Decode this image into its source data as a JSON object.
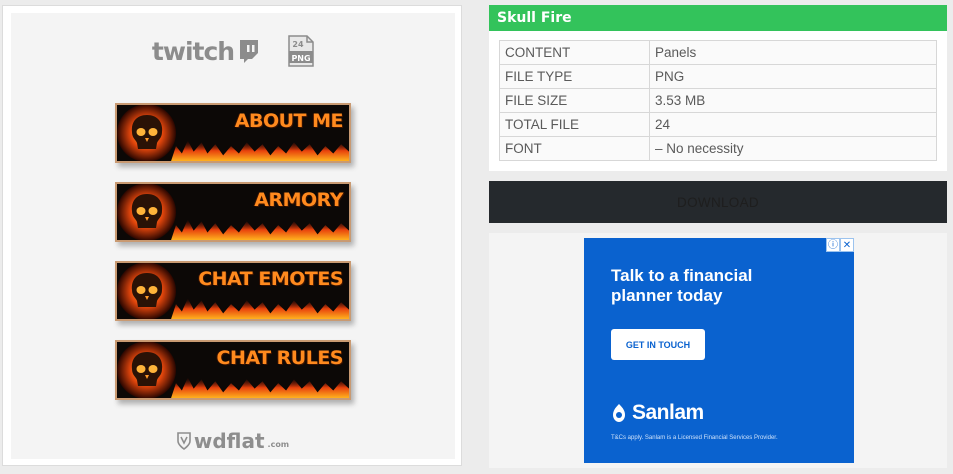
{
  "preview": {
    "platform_logo_text": "twitch",
    "png_badge": {
      "top": "24",
      "bottom": "PNG"
    },
    "panels": [
      {
        "label": "ABOUT ME"
      },
      {
        "label": "ARMORY"
      },
      {
        "label": "CHAT EMOTES"
      },
      {
        "label": "CHAT RULES"
      }
    ],
    "watermark": {
      "name": "wdflat",
      "suffix": ".com"
    }
  },
  "product": {
    "title": "Skull Fire",
    "details": [
      {
        "key": "CONTENT",
        "value": "Panels"
      },
      {
        "key": "FILE TYPE",
        "value": "PNG"
      },
      {
        "key": "FILE SIZE",
        "value": "3.53 MB"
      },
      {
        "key": "TOTAL FILE",
        "value": "24"
      },
      {
        "key": "FONT",
        "value": "– No necessity"
      }
    ],
    "download_label": "DOWNLOAD"
  },
  "ad": {
    "info_icon": "ⓘ",
    "close_icon": "✕",
    "headline": "Talk to a financial planner today",
    "cta_label": "GET IN TOUCH",
    "brand": "Sanlam",
    "disclaimer": "T&Cs apply. Sanlam is a Licensed Financial Services Provider."
  },
  "colors": {
    "title_bar": "#33c35b",
    "download_bg": "#25292d",
    "ad_bg": "#0a62cf",
    "panel_text": "#ff8a1e"
  }
}
